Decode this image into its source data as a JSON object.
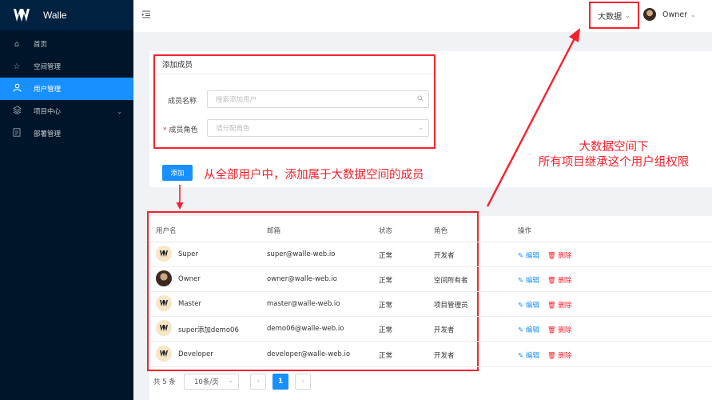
{
  "app": {
    "name": "Walle"
  },
  "sidebar": {
    "items": [
      {
        "label": "首页",
        "icon": "home-icon"
      },
      {
        "label": "空间管理",
        "icon": "star-icon"
      },
      {
        "label": "用户管理",
        "icon": "user-icon",
        "active": true
      },
      {
        "label": "项目中心",
        "icon": "layers-icon",
        "has_submenu": true
      },
      {
        "label": "部署管理",
        "icon": "document-icon"
      }
    ]
  },
  "header": {
    "space": "大数据",
    "user": "Owner"
  },
  "add_member": {
    "title": "添加成员",
    "member_label": "成员名称",
    "member_placeholder": "搜索添加用户",
    "role_label": "成员角色",
    "role_placeholder": "请分配角色",
    "add_button": "添加"
  },
  "annotations": {
    "add_note": "从全部用户中，添加属于大数据空间的成员",
    "space_note_line1": "大数据空间下",
    "space_note_line2": "所有项目继承这个用户组权限"
  },
  "table": {
    "columns": [
      "用户名",
      "邮箱",
      "状态",
      "角色",
      "操作"
    ],
    "edit_label": "编辑",
    "delete_label": "删除",
    "rows": [
      {
        "name": "Super",
        "email": "super@walle-web.io",
        "status": "正常",
        "role": "开发者",
        "avatar": "logo"
      },
      {
        "name": "Owner",
        "email": "owner@walle-web.io",
        "status": "正常",
        "role": "空间所有者",
        "avatar": "photo"
      },
      {
        "name": "Master",
        "email": "master@walle-web.io",
        "status": "正常",
        "role": "项目管理员",
        "avatar": "logo"
      },
      {
        "name": "super添加demo06",
        "email": "demo06@walle-web.io",
        "status": "正常",
        "role": "开发者",
        "avatar": "logo"
      },
      {
        "name": "Developer",
        "email": "developer@walle-web.io",
        "status": "正常",
        "role": "开发者",
        "avatar": "logo"
      }
    ]
  },
  "pagination": {
    "total_text": "共 5 条",
    "page_size": "10条/页",
    "current_page": "1",
    "prev": "‹",
    "next": "›"
  },
  "colors": {
    "accent": "#1890ff",
    "annotation": "#f5222d",
    "sidebar": "#001529",
    "danger": "#f5222d"
  }
}
